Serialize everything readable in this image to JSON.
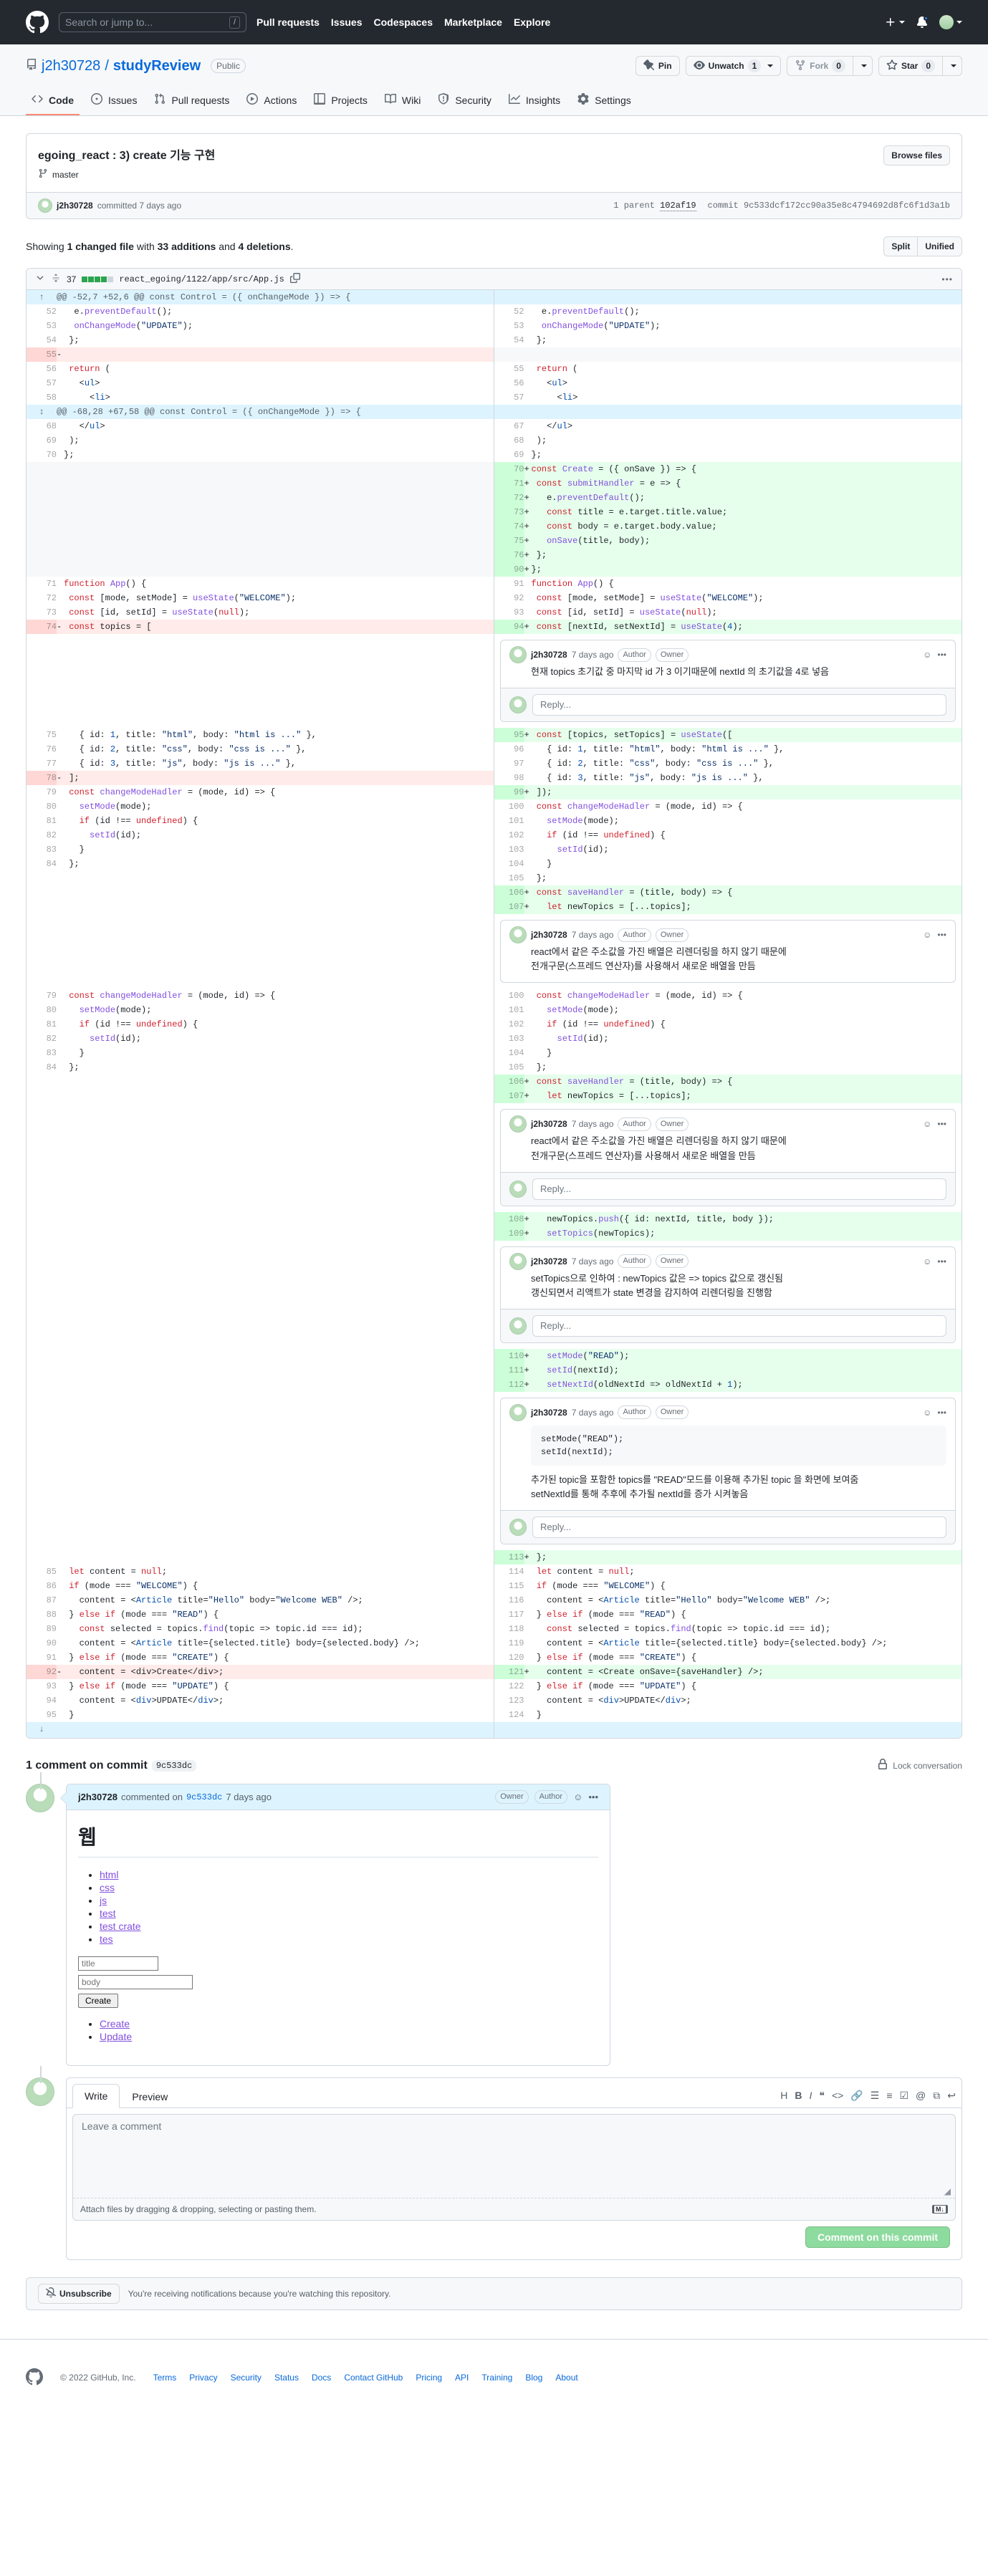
{
  "header": {
    "search_placeholder": "Search or jump to...",
    "slash_hint": "/",
    "nav": [
      {
        "label": "Pull requests"
      },
      {
        "label": "Issues"
      },
      {
        "label": "Codespaces"
      },
      {
        "label": "Marketplace"
      },
      {
        "label": "Explore"
      }
    ]
  },
  "repo": {
    "owner": "j2h30728",
    "separator": "/",
    "name": "studyReview",
    "visibility": "Public",
    "actions": {
      "pin": "Pin",
      "watch": "Unwatch",
      "watch_count": "1",
      "fork": "Fork",
      "fork_count": "0",
      "star": "Star",
      "star_count": "0"
    },
    "nav": [
      {
        "label": "Code",
        "icon": "code-icon",
        "active": true
      },
      {
        "label": "Issues",
        "icon": "issue-opened-icon",
        "active": false
      },
      {
        "label": "Pull requests",
        "icon": "git-pull-request-icon",
        "active": false
      },
      {
        "label": "Actions",
        "icon": "play-icon",
        "active": false
      },
      {
        "label": "Projects",
        "icon": "table-icon",
        "active": false
      },
      {
        "label": "Wiki",
        "icon": "book-icon",
        "active": false
      },
      {
        "label": "Security",
        "icon": "shield-icon",
        "active": false
      },
      {
        "label": "Insights",
        "icon": "graph-icon",
        "active": false
      },
      {
        "label": "Settings",
        "icon": "gear-icon",
        "active": false
      }
    ]
  },
  "commit": {
    "title": "egoing_react : 3) create 기능 구현",
    "branch": "master",
    "browse_files": "Browse files",
    "author": "j2h30728",
    "committed_text": "committed 7 days ago",
    "parent_label": "1 parent",
    "parent_sha": "102af19",
    "commit_label": "commit",
    "commit_sha": "9c533dcf172cc90a35e8c4794692d8fc6f1d3a1b",
    "short_sha": "9c533dc"
  },
  "diff_summary": {
    "prefix": "Showing",
    "files": "1 changed file",
    "middle": "with",
    "additions": "33 additions",
    "and": "and",
    "deletions": "4 deletions",
    "suffix": ".",
    "split_label": "Split",
    "unified_label": "Unified"
  },
  "file": {
    "changes_count": "37",
    "path": "react_egoing/1122/app/src/App.js",
    "copy_icon": "copy-icon",
    "kebab_icon": "kebab-horizontal-icon",
    "diffstat_blocks": [
      1,
      1,
      1,
      1,
      0
    ]
  },
  "hunks": {
    "h1": "@@ -52,7 +52,6 @@ const Control = ({ onChangeMode }) => {",
    "h2": "@@ -68,28 +67,58 @@ const Control = ({ onChangeMode }) => {"
  },
  "code_lines": [
    {
      "ln": "52",
      "rn": "52",
      "type": "ctx",
      "text": "    e.preventDefault();"
    },
    {
      "ln": "53",
      "rn": "53",
      "type": "ctx",
      "text": "    onChangeMode(\"UPDATE\");"
    },
    {
      "ln": "54",
      "rn": "54",
      "type": "ctx",
      "text": "  };"
    },
    {
      "ln": "55",
      "rn": "",
      "type": "del",
      "text": ""
    },
    {
      "ln": "56",
      "rn": "55",
      "type": "ctx",
      "text": "  return ("
    },
    {
      "ln": "57",
      "rn": "56",
      "type": "ctx",
      "text": "    <ul>"
    },
    {
      "ln": "58",
      "rn": "57",
      "type": "ctx",
      "text": "      <li>"
    }
  ],
  "code_lines2": [
    {
      "ln": "68",
      "rn": "67",
      "type": "ctx",
      "text": "    </ul>"
    },
    {
      "ln": "69",
      "rn": "68",
      "type": "ctx",
      "text": "  );"
    },
    {
      "ln": "70",
      "rn": "69",
      "type": "ctx",
      "text": "};"
    }
  ],
  "added_block1": [
    {
      "rn": "70",
      "text": "const Create = ({ onSave }) => {"
    },
    {
      "rn": "71",
      "text": "  const submitHandler = e => {"
    },
    {
      "rn": "72",
      "text": "    e.preventDefault();"
    },
    {
      "rn": "73",
      "text": "    const title = e.target.title.value;"
    },
    {
      "rn": "74",
      "text": "    const body = e.target.body.value;"
    },
    {
      "rn": "75",
      "text": "    onSave(title, body);"
    },
    {
      "rn": "76",
      "text": "  };"
    },
    {
      "rn": "90",
      "text": "};"
    }
  ],
  "left_block1": [
    {
      "ln": "71",
      "text": "function App() {"
    },
    {
      "ln": "72",
      "text": "  const [mode, setMode] = useState(\"WELCOME\");"
    },
    {
      "ln": "73",
      "text": "  const [id, setId] = useState(null);"
    },
    {
      "ln": "74",
      "type": "del",
      "text": "  const topics = ["
    }
  ],
  "right_block1": [
    {
      "rn": "91",
      "type": "ctx",
      "text": "function App() {"
    },
    {
      "rn": "92",
      "type": "ctx",
      "text": "  const [mode, setMode] = useState(\"WELCOME\");"
    },
    {
      "rn": "93",
      "type": "ctx",
      "text": "  const [id, setId] = useState(null);"
    },
    {
      "rn": "94",
      "type": "add",
      "text": "  const [nextId, setNextId] = useState(4);"
    }
  ],
  "left_block2": [
    {
      "ln": "75",
      "text": "    { id: 1, title: \"html\", body: \"html is ...\" },"
    },
    {
      "ln": "76",
      "text": "    { id: 2, title: \"css\", body: \"css is ...\" },"
    },
    {
      "ln": "77",
      "text": "    { id: 3, title: \"js\", body: \"js is ...\" },"
    },
    {
      "ln": "78",
      "type": "del",
      "text": "  ];"
    },
    {
      "ln": "79",
      "text": "  const changeModeHadler = (mode, id) => {"
    },
    {
      "ln": "80",
      "text": "    setMode(mode);"
    },
    {
      "ln": "81",
      "text": "    if (id !== undefined) {"
    },
    {
      "ln": "82",
      "text": "      setId(id);"
    },
    {
      "ln": "83",
      "text": "    }"
    },
    {
      "ln": "84",
      "text": "  };"
    }
  ],
  "right_block2": [
    {
      "rn": "95",
      "type": "add",
      "text": "  const [topics, setTopics] = useState(["
    },
    {
      "rn": "96",
      "type": "ctx",
      "text": "    { id: 1, title: \"html\", body: \"html is ...\" },"
    },
    {
      "rn": "97",
      "type": "ctx",
      "text": "    { id: 2, title: \"css\", body: \"css is ...\" },"
    },
    {
      "rn": "98",
      "type": "ctx",
      "text": "    { id: 3, title: \"js\", body: \"js is ...\" },"
    },
    {
      "rn": "99",
      "type": "add",
      "text": "  ]);"
    },
    {
      "rn": "100",
      "type": "ctx",
      "text": "  const changeModeHadler = (mode, id) => {"
    },
    {
      "rn": "101",
      "type": "ctx",
      "text": "    setMode(mode);"
    },
    {
      "rn": "102",
      "type": "ctx",
      "text": "    if (id !== undefined) {"
    },
    {
      "rn": "103",
      "type": "ctx",
      "text": "      setId(id);"
    },
    {
      "rn": "104",
      "type": "ctx",
      "text": "    }"
    },
    {
      "rn": "105",
      "type": "ctx",
      "text": "  };"
    },
    {
      "rn": "106",
      "type": "add",
      "text": "  const saveHandler = (title, body) => {"
    },
    {
      "rn": "107",
      "type": "add",
      "text": "    let newTopics = [...topics];"
    }
  ],
  "left_block3": [
    {
      "ln": "79",
      "text": "  const changeModeHadler = (mode, id) => {"
    },
    {
      "ln": "80",
      "text": "    setMode(mode);"
    },
    {
      "ln": "81",
      "text": "    if (id !== undefined) {"
    },
    {
      "ln": "82",
      "text": "      setId(id);"
    },
    {
      "ln": "83",
      "text": "    }"
    },
    {
      "ln": "84",
      "text": "  };"
    }
  ],
  "right_block3": [
    {
      "rn": "100",
      "type": "ctx",
      "text": "  const changeModeHadler = (mode, id) => {"
    },
    {
      "rn": "101",
      "type": "ctx",
      "text": "    setMode(mode);"
    },
    {
      "rn": "102",
      "type": "ctx",
      "text": "    if (id !== undefined) {"
    },
    {
      "rn": "103",
      "type": "ctx",
      "text": "      setId(id);"
    },
    {
      "rn": "104",
      "type": "ctx",
      "text": "    }"
    },
    {
      "rn": "105",
      "type": "ctx",
      "text": "  };"
    },
    {
      "rn": "106",
      "type": "add",
      "text": "  const saveHandler = (title, body) => {"
    },
    {
      "rn": "107",
      "type": "add",
      "text": "    let newTopics = [...topics];"
    }
  ],
  "right_block4": [
    {
      "rn": "108",
      "type": "add",
      "text": "    newTopics.push({ id: nextId, title, body });"
    },
    {
      "rn": "109",
      "type": "add",
      "text": "    setTopics(newTopics);"
    }
  ],
  "right_block5": [
    {
      "rn": "110",
      "type": "add",
      "text": "    setMode(\"READ\");"
    },
    {
      "rn": "111",
      "type": "add",
      "text": "    setId(nextId);"
    },
    {
      "rn": "112",
      "type": "add",
      "text": "    setNextId(oldNextId => oldNextId + 1);"
    }
  ],
  "left_tail": [
    {
      "ln": "85",
      "text": "  let content = null;"
    },
    {
      "ln": "86",
      "text": "  if (mode === \"WELCOME\") {"
    },
    {
      "ln": "87",
      "text": "    content = <Article title=\"Hello\" body=\"Welcome WEB\" />;"
    },
    {
      "ln": "88",
      "text": "  } else if (mode === \"READ\") {"
    },
    {
      "ln": "89",
      "text": "    const selected = topics.find(topic => topic.id === id);"
    },
    {
      "ln": "90",
      "text": "    content = <Article title={selected.title} body={selected.body} />;"
    },
    {
      "ln": "91",
      "text": "  } else if (mode === \"CREATE\") {"
    },
    {
      "ln": "92",
      "type": "del",
      "text": "    content = <div>Create</div>;"
    },
    {
      "ln": "93",
      "text": "  } else if (mode === \"UPDATE\") {"
    },
    {
      "ln": "94",
      "text": "    content = <div>UPDATE</div>;"
    },
    {
      "ln": "95",
      "text": "  }"
    }
  ],
  "right_tail": [
    {
      "rn": "113",
      "type": "add",
      "text": "  };"
    },
    {
      "rn": "114",
      "type": "ctx",
      "text": "  let content = null;"
    },
    {
      "rn": "115",
      "type": "ctx",
      "text": "  if (mode === \"WELCOME\") {"
    },
    {
      "rn": "116",
      "type": "ctx",
      "text": "    content = <Article title=\"Hello\" body=\"Welcome WEB\" />;"
    },
    {
      "rn": "117",
      "type": "ctx",
      "text": "  } else if (mode === \"READ\") {"
    },
    {
      "rn": "118",
      "type": "ctx",
      "text": "    const selected = topics.find(topic => topic.id === id);"
    },
    {
      "rn": "119",
      "type": "ctx",
      "text": "    content = <Article title={selected.title} body={selected.body} />;"
    },
    {
      "rn": "120",
      "type": "ctx",
      "text": "  } else if (mode === \"CREATE\") {"
    },
    {
      "rn": "121",
      "type": "add",
      "text": "    content = <Create onSave={saveHandler} />;"
    },
    {
      "rn": "122",
      "type": "ctx",
      "text": "  } else if (mode === \"UPDATE\") {"
    },
    {
      "rn": "123",
      "type": "ctx",
      "text": "    content = <div>UPDATE</div>;"
    },
    {
      "rn": "124",
      "type": "ctx",
      "text": "  }"
    }
  ],
  "inline_comments": [
    {
      "user": "j2h30728",
      "when": "7 days ago",
      "badges": [
        "Author",
        "Owner"
      ],
      "body": "현재 topics 초기값 중 마지막 id 가 3 이기때문에 nextId 의 초기값을 4로 넣음",
      "code": "",
      "reply_placeholder": "Reply..."
    },
    {
      "user": "j2h30728",
      "when": "7 days ago",
      "badges": [
        "Author",
        "Owner"
      ],
      "body": "react에서 같은 주소값을 가진 배열은 리렌더링을 하지 않기 때문에\n전개구문(스프레드 연산자)를 사용해서 새로운 배열을 만듬",
      "code": "",
      "reply_placeholder": "Reply..."
    },
    {
      "user": "j2h30728",
      "when": "7 days ago",
      "badges": [
        "Author",
        "Owner"
      ],
      "body": "react에서 같은 주소값을 가진 배열은 리렌더링을 하지 않기 때문에\n전개구문(스프레드 연산자)를 사용해서 새로운 배열을 만듬",
      "code": "",
      "reply_placeholder": "Reply..."
    },
    {
      "user": "j2h30728",
      "when": "7 days ago",
      "badges": [
        "Author",
        "Owner"
      ],
      "body": "setTopics으로 인하여 : newTopics 값은 => topics 값으로 갱신됨\n갱신되면서 리액트가 state 변경을 감지하여 리렌더링을 진행함",
      "code": "",
      "reply_placeholder": "Reply..."
    },
    {
      "user": "j2h30728",
      "when": "7 days ago",
      "badges": [
        "Author",
        "Owner"
      ],
      "body": "추가된 topic을 포함한 topics를 \"READ\"모드를 이용해 추가된 topic 을 화면에 보여줌\nsetNextId를 통해 추후에 추가될 nextId를 증가 시켜놓음",
      "code": "setMode(\"READ\");\nsetId(nextId);",
      "reply_placeholder": "Reply..."
    }
  ],
  "commit_comments": {
    "heading": "1 comment on commit",
    "sha_chip": "9c533dc",
    "lock_label": "Lock conversation",
    "comment": {
      "user": "j2h30728",
      "action": "commented on",
      "sha": "9c533dc",
      "when": "7 days ago",
      "badges": [
        "Owner",
        "Author"
      ],
      "title": "웹",
      "links": [
        "html",
        "css",
        "js",
        "test",
        "test crate",
        "tes"
      ],
      "input_title_placeholder": "title",
      "input_body_placeholder": "body",
      "create_button": "Create",
      "bottom_links": [
        "Create",
        "Update"
      ]
    }
  },
  "comment_form": {
    "tabs": [
      {
        "label": "Write",
        "active": true
      },
      {
        "label": "Preview",
        "active": false
      }
    ],
    "toolbar": [
      {
        "icon": "heading-icon",
        "glyph": "H"
      },
      {
        "icon": "bold-icon",
        "glyph": "B"
      },
      {
        "icon": "italic-icon",
        "glyph": "I"
      },
      {
        "icon": "quote-icon",
        "glyph": "❝"
      },
      {
        "icon": "code-icon",
        "glyph": "<>"
      },
      {
        "icon": "link-icon",
        "glyph": "🔗"
      },
      {
        "icon": "unordered-list-icon",
        "glyph": "☰"
      },
      {
        "icon": "ordered-list-icon",
        "glyph": "≡"
      },
      {
        "icon": "task-list-icon",
        "glyph": "☑"
      },
      {
        "icon": "mention-icon",
        "glyph": "@"
      },
      {
        "icon": "cross-reference-icon",
        "glyph": "⧉"
      },
      {
        "icon": "reply-icon",
        "glyph": "↩"
      }
    ],
    "textarea_placeholder": "Leave a comment",
    "attach_text": "Attach files by dragging & dropping, selecting or pasting them.",
    "markdown_badge": "M↓",
    "submit_label": "Comment on this commit"
  },
  "notice": {
    "button": "Unsubscribe",
    "text": "You're receiving notifications because you're watching this repository."
  },
  "footer": {
    "copyright": "© 2022 GitHub, Inc.",
    "links": [
      "Terms",
      "Privacy",
      "Security",
      "Status",
      "Docs",
      "Contact GitHub",
      "Pricing",
      "API",
      "Training",
      "Blog",
      "About"
    ]
  }
}
